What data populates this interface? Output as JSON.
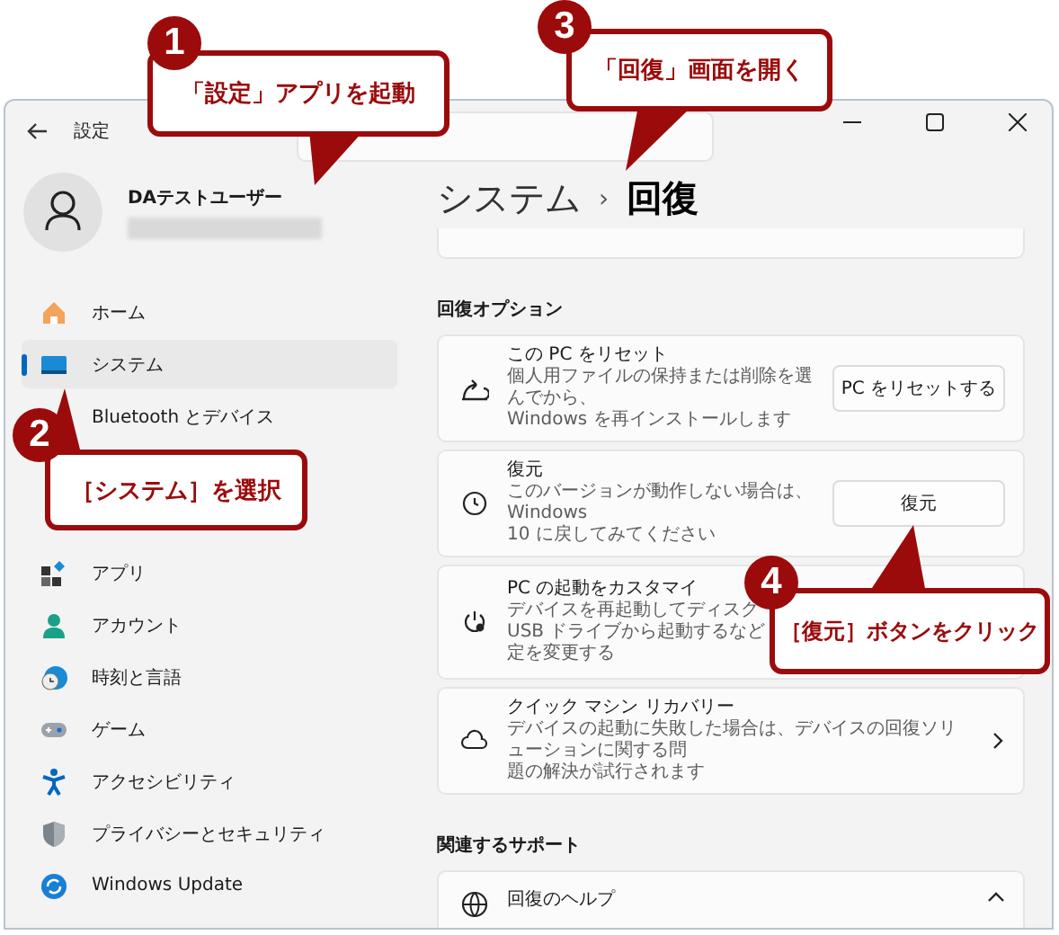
{
  "window": {
    "title": "設定"
  },
  "profile": {
    "name": "DAテストユーザー"
  },
  "sidebar": {
    "items": [
      {
        "label": "ホーム",
        "selected": false
      },
      {
        "label": "システム",
        "selected": true
      },
      {
        "label": "Bluetooth とデバイス",
        "selected": false
      },
      {
        "label": "アプリ",
        "selected": false
      },
      {
        "label": "アカウント",
        "selected": false
      },
      {
        "label": "時刻と言語",
        "selected": false
      },
      {
        "label": "ゲーム",
        "selected": false
      },
      {
        "label": "アクセシビリティ",
        "selected": false
      },
      {
        "label": "プライバシーとセキュリティ",
        "selected": false
      },
      {
        "label": "Windows Update",
        "selected": false
      }
    ]
  },
  "page": {
    "breadcrumb": [
      "システム",
      "回復"
    ],
    "separator": "›"
  },
  "sections": [
    {
      "heading": "回復オプション",
      "cards": [
        {
          "kind": "button",
          "title": "この PC をリセット",
          "lines": [
            "個人用ファイルの保持または削除を選んでから、",
            "Windows を再インストールします"
          ],
          "button": "PC をリセットする"
        },
        {
          "kind": "button",
          "title": "復元",
          "lines": [
            "このバージョンが動作しない場合は、Windows",
            "10 に戻してみてください"
          ],
          "button": "復元"
        },
        {
          "kind": "plain",
          "title": "PC の起動をカスタマイ",
          "lines": [
            "デバイスを再起動してディスク",
            "USB ドライブから起動するなど",
            "定を変更する"
          ]
        },
        {
          "kind": "link",
          "title": "クイック マシン リカバリー",
          "lines": [
            "デバイスの起動に失敗した場合は、デバイスの回復ソリューションに関する問",
            "題の解決が試行されます"
          ]
        }
      ]
    },
    {
      "heading": "関連するサポート",
      "cards": [
        {
          "kind": "expander",
          "title": "回復のヘルプ",
          "expanded": true
        }
      ]
    }
  ],
  "callouts": [
    {
      "number": "1",
      "text": "「設定」アプリを起動"
    },
    {
      "number": "2",
      "text": "［システム］を選択"
    },
    {
      "number": "3",
      "text": "「回復」画面を開く"
    },
    {
      "number": "4",
      "text": "［復元］ボタンをクリック"
    }
  ]
}
